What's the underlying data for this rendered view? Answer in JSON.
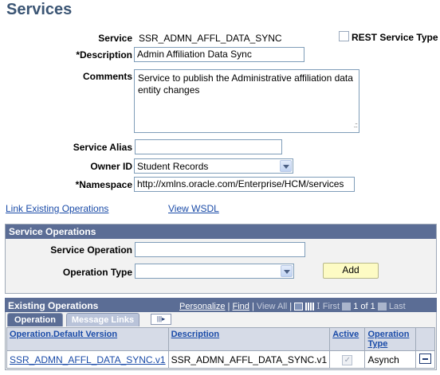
{
  "page": {
    "title": "Services"
  },
  "form": {
    "service": {
      "label": "Service",
      "value": "SSR_ADMN_AFFL_DATA_SYNC"
    },
    "rest": {
      "label": "REST Service Type",
      "checked": false
    },
    "description": {
      "label": "*Description",
      "value": "Admin Affiliation Data Sync"
    },
    "comments": {
      "label": "Comments",
      "value": "Service to publish the Administrative affiliation data entity changes"
    },
    "alias": {
      "label": "Service Alias",
      "value": ""
    },
    "owner": {
      "label": "Owner ID",
      "value": "Student Records"
    },
    "namespace": {
      "label": "*Namespace",
      "value": "http://xmlns.oracle.com/Enterprise/HCM/services"
    }
  },
  "links": {
    "link_existing": "Link Existing Operations",
    "view_wsdl": "View WSDL"
  },
  "service_operations": {
    "title": "Service Operations",
    "operation_label": "Service Operation",
    "operation_value": "",
    "type_label": "Operation Type",
    "type_value": "",
    "add_label": "Add"
  },
  "existing": {
    "title": "Existing Operations",
    "nav": {
      "personalize": "Personalize",
      "sep1": "|",
      "find": "Find",
      "sep2": "|",
      "view_all": "View All",
      "sep3": "|",
      "first": "First",
      "range": "1 of 1",
      "last": "Last"
    },
    "tabs": [
      "Operation",
      "Message Links"
    ],
    "columns": [
      "Operation.Default Version",
      "Description",
      "Active",
      "Operation Type"
    ],
    "rows": [
      {
        "operation": "SSR_ADMN_AFFL_DATA_SYNC.v1",
        "description": "SSR_ADMN_AFFL_DATA_SYNC.v1",
        "active": true,
        "type": "Asynch"
      }
    ]
  },
  "icons": {
    "download": "download-excel-icon",
    "grid": "grid-view-icon",
    "prev": "prev-arrow-icon",
    "next": "next-arrow-icon",
    "show_all_columns": "show-all-columns-icon",
    "delete_row": "delete-row-icon",
    "cursor": "text-cursor-icon"
  },
  "colors": {
    "title": "#3b5574",
    "header_bar": "#5b6d95",
    "link": "#1a4ba8",
    "add_button": "#fdfbc4"
  }
}
